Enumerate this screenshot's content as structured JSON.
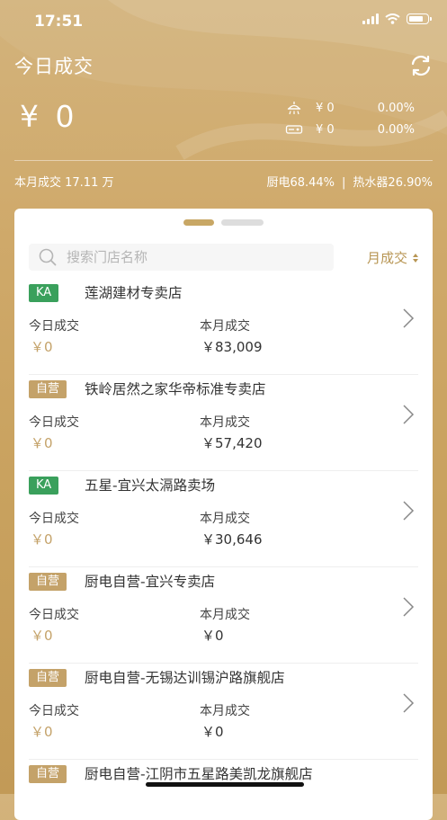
{
  "status": {
    "time": "17:51"
  },
  "header": {
    "title": "今日成交",
    "amount": "¥ 0",
    "categories": [
      {
        "icon": "shower-icon",
        "amount": "¥ 0",
        "percent": "0.00%"
      },
      {
        "icon": "range-hood-icon",
        "amount": "¥ 0",
        "percent": "0.00%"
      }
    ],
    "month_total": "本月成交 17.11 万",
    "ratio_kitchen": "厨电68.44%",
    "ratio_sep": "|",
    "ratio_heater": "热水器26.90%"
  },
  "search": {
    "placeholder": "搜索门店名称"
  },
  "sort": {
    "label": "月成交"
  },
  "labels": {
    "today": "今日成交",
    "month": "本月成交"
  },
  "stores": [
    {
      "tag": "KA",
      "tag_type": "ka",
      "name": "莲湖建材专卖店",
      "today": "￥0",
      "month": "￥83,009"
    },
    {
      "tag": "自营",
      "tag_type": "zy",
      "name": "铁岭居然之家华帝标准专卖店",
      "today": "￥0",
      "month": "￥57,420"
    },
    {
      "tag": "KA",
      "tag_type": "ka",
      "name": "五星-宜兴太滆路卖场",
      "today": "￥0",
      "month": "￥30,646"
    },
    {
      "tag": "自营",
      "tag_type": "zy",
      "name": "厨电自营-宜兴专卖店",
      "today": "￥0",
      "month": "￥0"
    },
    {
      "tag": "自营",
      "tag_type": "zy",
      "name": "厨电自营-无锡达训锡沪路旗舰店",
      "today": "￥0",
      "month": "￥0"
    },
    {
      "tag": "自营",
      "tag_type": "zy",
      "name": "厨电自营-江阴市五星路美凯龙旗舰店",
      "today": "",
      "month": ""
    }
  ]
}
